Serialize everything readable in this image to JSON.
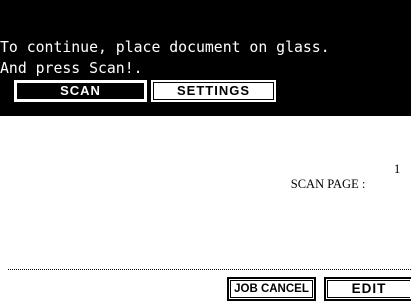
{
  "header": {
    "message_line1": "To continue, place document on glass.",
    "message_line2": "And press Scan!."
  },
  "tabs": [
    {
      "label": "SCAN",
      "active": true
    },
    {
      "label": "SETTINGS",
      "active": false
    }
  ],
  "content": {
    "scan_page_label": "SCAN PAGE :",
    "scan_page_value": "1"
  },
  "buttons": {
    "job_cancel": "JOB CANCEL",
    "edit": "EDIT"
  },
  "colors": {
    "background": "#ffffff",
    "header_background": "#000000",
    "text": "#000000",
    "header_text": "#ffffff"
  }
}
